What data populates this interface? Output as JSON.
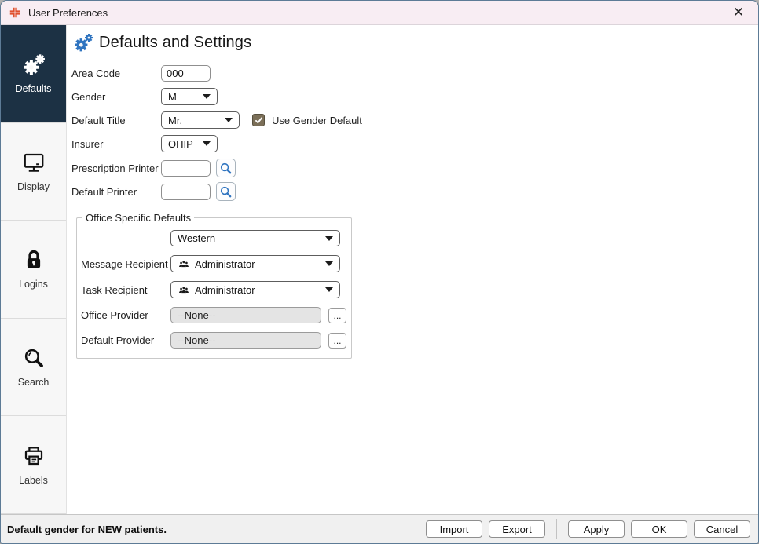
{
  "window": {
    "title": "User Preferences",
    "close_glyph": "✕"
  },
  "sidebar": {
    "items": [
      {
        "label": "Defaults",
        "icon": "gears-icon",
        "selected": true
      },
      {
        "label": "Display",
        "icon": "monitor-icon",
        "selected": false
      },
      {
        "label": "Logins",
        "icon": "lock-icon",
        "selected": false
      },
      {
        "label": "Search",
        "icon": "magnifier-icon",
        "selected": false
      },
      {
        "label": "Labels",
        "icon": "printer-icon",
        "selected": false
      }
    ]
  },
  "content": {
    "heading": "Defaults and Settings",
    "fields": {
      "area_code": {
        "label": "Area Code",
        "value": "000"
      },
      "gender": {
        "label": "Gender",
        "value": "M"
      },
      "default_title": {
        "label": "Default Title",
        "value": "Mr.",
        "checkbox_label": "Use Gender Default",
        "checkbox_checked": true
      },
      "insurer": {
        "label": "Insurer",
        "value": "OHIP"
      },
      "prescription_printer": {
        "label": "Prescription Printer",
        "value": ""
      },
      "default_printer": {
        "label": "Default Printer",
        "value": ""
      }
    },
    "office_group": {
      "legend": "Office Specific Defaults",
      "office_select": {
        "value": "Western"
      },
      "message_recipient": {
        "label": "Message Recipient",
        "value": "Administrator",
        "icon": "people-group-icon"
      },
      "task_recipient": {
        "label": "Task Recipient",
        "value": "Administrator",
        "icon": "people-group-icon"
      },
      "office_provider": {
        "label": "Office Provider",
        "value": "--None--",
        "button_label": "..."
      },
      "default_provider": {
        "label": "Default Provider",
        "value": "--None--",
        "button_label": "..."
      }
    }
  },
  "footer": {
    "status": "Default gender for NEW patients.",
    "import_label": "Import",
    "export_label": "Export",
    "apply_label": "Apply",
    "ok_label": "OK",
    "cancel_label": "Cancel"
  },
  "colors": {
    "titlebar_bg": "#f8edf3",
    "window_border": "#5d7b96",
    "tab_selected_bg": "#1c3144",
    "sidebar_bg": "#f7f7f7",
    "accent_blue": "#2f74c0",
    "icon_red": "#e0512e",
    "checkbox_bg": "#7b6f58",
    "footer_bg": "#f0f0f0",
    "disabled_bg": "#e4e4e4"
  }
}
